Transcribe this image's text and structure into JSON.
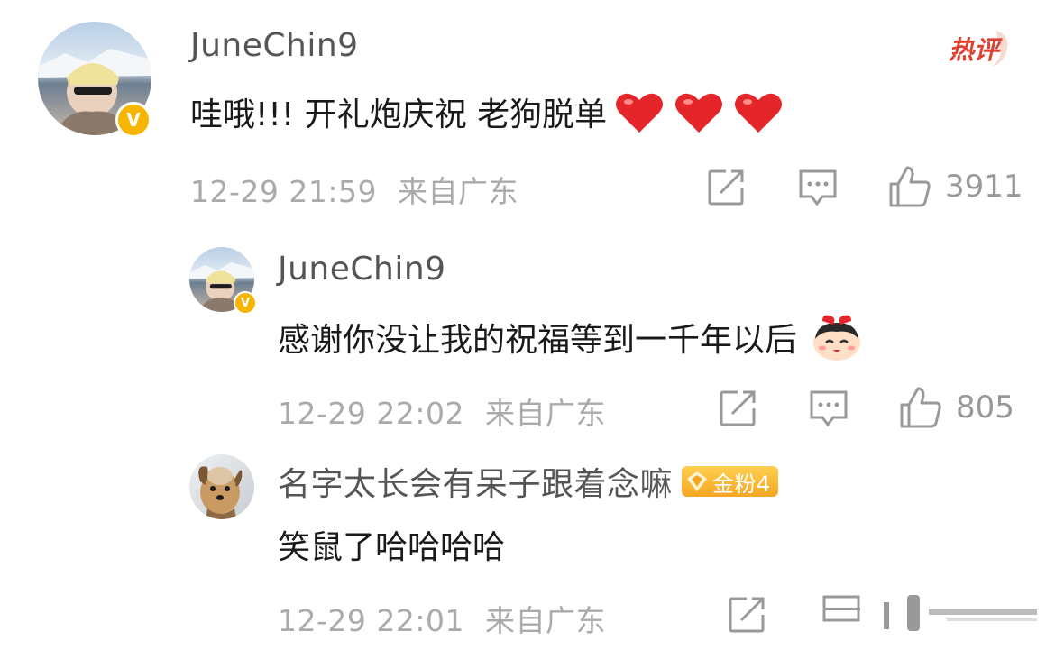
{
  "comment": {
    "username": "JuneChin9",
    "hot_tag": "热评",
    "text": "哇哦!!! 开礼炮庆祝 老狗脱单",
    "time": "12-29 21:59",
    "location": "来自广东",
    "likes": "3911",
    "verified_badge": "V",
    "icons": [
      "avatar",
      "verified-badge",
      "heart-emoji",
      "share-icon",
      "comment-icon",
      "like-icon"
    ]
  },
  "replies": [
    {
      "username": "JuneChin9",
      "text": "感谢你没让我的祝福等到一千年以后",
      "time": "12-29 22:02",
      "location": "来自广东",
      "likes": "805",
      "verified_badge": "V"
    },
    {
      "username": "名字太长会有呆子跟着念嘛",
      "fan_badge": "金粉4",
      "text": "笑鼠了哈哈哈哈",
      "time": "12-29 22:01",
      "location": "来自广东"
    }
  ],
  "colors": {
    "hot_tag": "#e0412f",
    "verified_badge": "#f7b500",
    "heart": "#e4262b",
    "meta_text": "#aaaaaa"
  }
}
